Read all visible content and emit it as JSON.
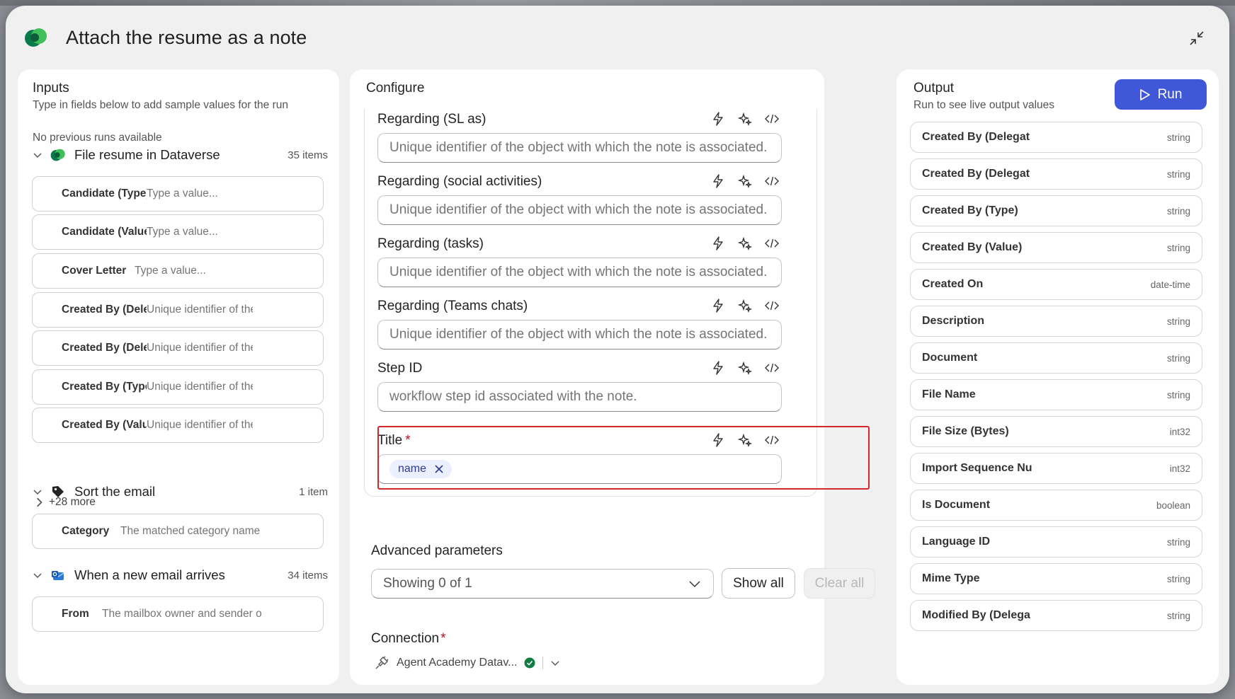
{
  "title": "Attach the resume as a note",
  "inputs": {
    "heading": "Inputs",
    "subtitle": "Type in fields below to add sample values for the run",
    "no_runs": "No previous runs available",
    "groups": [
      {
        "name": "File resume in Dataverse",
        "count": "35 items",
        "fields": [
          {
            "label": "Candidate (Type)",
            "placeholder": "Type a value..."
          },
          {
            "label": "Candidate (Value",
            "placeholder": "Type a value..."
          },
          {
            "label": "Cover Letter",
            "placeholder": "Type a value..."
          },
          {
            "label": "Created By (Dele",
            "placeholder": "Unique identifier of the"
          },
          {
            "label": "Created By (Dele",
            "placeholder": "Unique identifier of the"
          },
          {
            "label": "Created By (Type",
            "placeholder": "Unique identifier of the"
          },
          {
            "label": "Created By (Value",
            "placeholder": "Unique identifier of the"
          }
        ],
        "more": "+28 more"
      },
      {
        "name": "Sort the email",
        "count": "1 item",
        "fields": [
          {
            "label": "Category",
            "placeholder": "The matched category name"
          }
        ]
      },
      {
        "name": "When a new email arrives",
        "count": "34 items",
        "fields": [
          {
            "label": "From",
            "placeholder": "The mailbox owner and sender o"
          }
        ]
      }
    ]
  },
  "configure": {
    "heading": "Configure",
    "fields": [
      {
        "label": "Regarding (SL as)",
        "placeholder": "Unique identifier of the object with which the note is associated.",
        "required": false
      },
      {
        "label": "Regarding (social activities)",
        "placeholder": "Unique identifier of the object with which the note is associated.",
        "required": false
      },
      {
        "label": "Regarding (tasks)",
        "placeholder": "Unique identifier of the object with which the note is associated.",
        "required": false
      },
      {
        "label": "Regarding (Teams chats)",
        "placeholder": "Unique identifier of the object with which the note is associated.",
        "required": false
      },
      {
        "label": "Step ID",
        "placeholder": "workflow step id associated with the note.",
        "required": false
      }
    ],
    "title_field": {
      "label": "Title",
      "required_mark": "*",
      "token": "name"
    },
    "advanced": {
      "label": "Advanced parameters",
      "select_value": "Showing 0 of 1",
      "show_all": "Show all",
      "clear_all": "Clear all"
    },
    "connection": {
      "label": "Connection",
      "required_mark": "*",
      "value": "Agent Academy Datav..."
    }
  },
  "output": {
    "heading": "Output",
    "subtitle": "Run to see live output values",
    "run_label": "Run",
    "items": [
      {
        "name": "Created By (Delegat",
        "type": "string"
      },
      {
        "name": "Created By (Delegat",
        "type": "string"
      },
      {
        "name": "Created By (Type)",
        "type": "string"
      },
      {
        "name": "Created By (Value)",
        "type": "string"
      },
      {
        "name": "Created On",
        "type": "date-time"
      },
      {
        "name": "Description",
        "type": "string"
      },
      {
        "name": "Document",
        "type": "string"
      },
      {
        "name": "File Name",
        "type": "string"
      },
      {
        "name": "File Size (Bytes)",
        "type": "int32"
      },
      {
        "name": "Import Sequence Nu",
        "type": "int32"
      },
      {
        "name": "Is Document",
        "type": "boolean"
      },
      {
        "name": "Language ID",
        "type": "string"
      },
      {
        "name": "Mime Type",
        "type": "string"
      },
      {
        "name": "Modified By (Delega",
        "type": "string"
      }
    ]
  },
  "colors": {
    "accent": "#4058d8",
    "highlight": "#d1272e",
    "required": "#c50f1f",
    "token_bg": "#ebefff",
    "success": "#107c41"
  },
  "icons": {
    "app": "dataverse-logo-icon",
    "minimize": "minimize-icon",
    "lightning": "lightning-icon",
    "sparkle": "sparkle-icon",
    "code": "code-icon",
    "chevron": "chevron-down-icon",
    "run": "play-icon",
    "tag": "tag-icon",
    "outlook": "outlook-icon",
    "plug": "plug-icon",
    "check": "check-circle-icon"
  }
}
